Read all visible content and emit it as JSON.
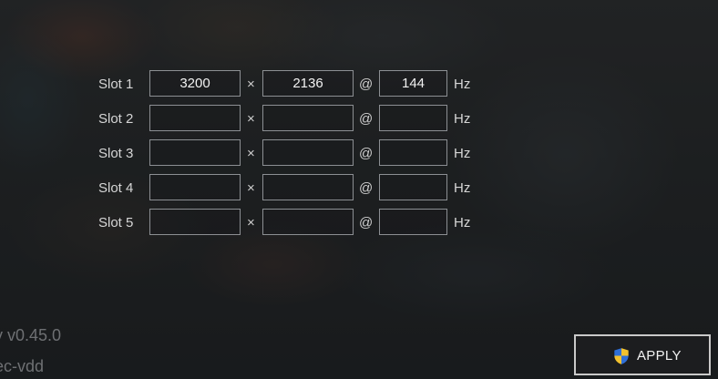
{
  "slots": [
    {
      "label": "Slot 1",
      "width": "3200",
      "height": "2136",
      "refresh": "144"
    },
    {
      "label": "Slot 2",
      "width": "",
      "height": "",
      "refresh": ""
    },
    {
      "label": "Slot 3",
      "width": "",
      "height": "",
      "refresh": ""
    },
    {
      "label": "Slot 4",
      "width": "",
      "height": "",
      "refresh": ""
    },
    {
      "label": "Slot 5",
      "width": "",
      "height": "",
      "refresh": ""
    }
  ],
  "separators": {
    "times": "×",
    "at": "@",
    "unit": "Hz"
  },
  "footer": {
    "version_text": "y v0.45.0",
    "repo_text": "ec-vdd"
  },
  "apply_button": {
    "label": "APPLY",
    "icon": "uac-shield-icon"
  },
  "colors": {
    "field_border": "#8c8f93",
    "text": "#d6d6d6",
    "button_border": "#c9c9c9",
    "shield_blue": "#2f6fd6",
    "shield_yellow": "#f2c12e"
  }
}
